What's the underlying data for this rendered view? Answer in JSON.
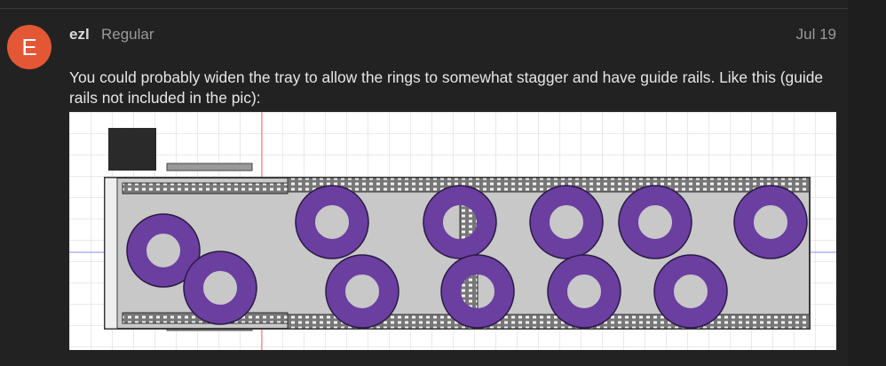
{
  "post": {
    "avatar": {
      "letter": "E",
      "color": "#e45735"
    },
    "username": "ezl",
    "user_title": "Regular",
    "date": "Jul 19",
    "body": "You could probably widen the tray to allow the rings to somewhat stagger and have guide rails. Like this (guide rails not included in the pic):"
  },
  "image": {
    "description_colors": {
      "ring": "#6a3fa0",
      "tray": "#b9b9b9",
      "frame": "#3a3a3a"
    }
  }
}
